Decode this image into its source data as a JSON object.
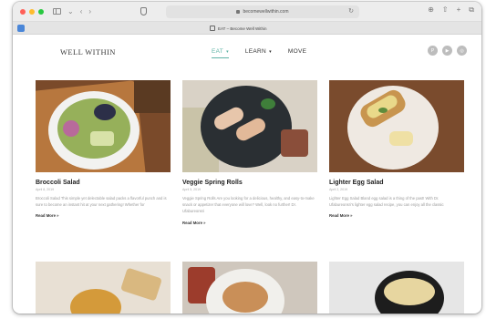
{
  "browser": {
    "url": "becomewellwithin.com",
    "tab_title": "EAT – Become Well Within",
    "colors": {
      "close": "#ff5f57",
      "minimize": "#febc2e",
      "zoom": "#28c840"
    },
    "icons": {
      "back": "‹",
      "forward": "›",
      "reload": "↻",
      "download": "⊕",
      "share": "⇧",
      "new_tab": "+",
      "tabs": "⧉"
    }
  },
  "site": {
    "logo": "WELL WITHIN",
    "nav": [
      {
        "label": "EAT",
        "active": true
      },
      {
        "label": "LEARN",
        "active": false
      },
      {
        "label": "MOVE",
        "active": false
      }
    ],
    "caret": "▾",
    "accent_color": "#5fb3a6",
    "social": [
      {
        "icon": "pinterest-icon",
        "glyph": "P"
      },
      {
        "icon": "youtube-icon",
        "glyph": "▶"
      },
      {
        "icon": "instagram-icon",
        "glyph": "◎"
      }
    ]
  },
  "posts": [
    {
      "title": "Broccoli Salad",
      "date": "April 8, 2019",
      "excerpt": "Broccoli Salad This simple yet delectable salad packs a flavorful punch and is sure to become an instant hit at your next gathering! Whether for",
      "read_more": "Read More »"
    },
    {
      "title": "Veggie Spring Rolls",
      "date": "April 5, 2019",
      "excerpt": "Veggie Spring Rolls Are you looking for a delicious, healthy, and easy-to-make snack or appetizer that everyone will love? Well, look no further! Dr. Ufabureonsri",
      "read_more": "Read More »"
    },
    {
      "title": "Lighter Egg Salad",
      "date": "April 2, 2019",
      "excerpt": "Lighter Egg Salad Bland egg salad is a thing of the past! With Dr. Ufabureonsri's lighter egg salad recipe, you can enjoy all the classic",
      "read_more": "Read More »"
    }
  ],
  "partial_row": [
    "thumb-4",
    "thumb-5",
    "thumb-6"
  ]
}
